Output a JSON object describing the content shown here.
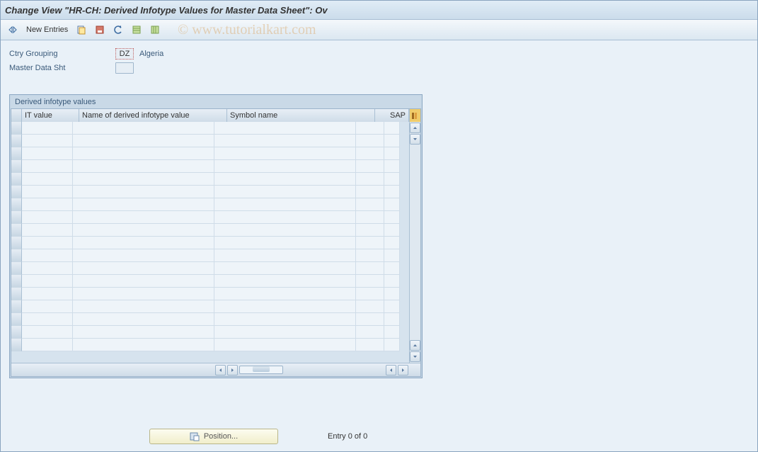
{
  "title": "Change View \"HR-CH: Derived Infotype Values for Master Data Sheet\": Ov",
  "watermark": "© www.tutorialkart.com",
  "toolbar": {
    "new_entries": "New Entries"
  },
  "fields": {
    "ctry_grouping_label": "Ctry Grouping",
    "ctry_grouping_value": "DZ",
    "ctry_grouping_desc": "Algeria",
    "master_data_label": "Master Data Sht",
    "master_data_value": ""
  },
  "table": {
    "title": "Derived infotype values",
    "columns": {
      "it_value": "IT value",
      "name": "Name of derived infotype value",
      "symbol": "Symbol name",
      "sap": "SAP"
    },
    "rows": []
  },
  "footer": {
    "position_label": "Position...",
    "entry_text": "Entry 0 of 0"
  }
}
